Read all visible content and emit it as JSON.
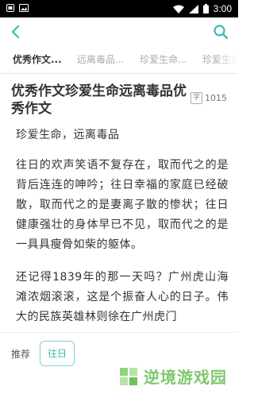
{
  "status_bar": {
    "time": "3:00"
  },
  "tabs": [
    {
      "label": "优秀作文..."
    },
    {
      "label": "远离毒品..."
    },
    {
      "label": "珍爱生命..."
    },
    {
      "label": "珍爱生命"
    }
  ],
  "article": {
    "title": "优秀作文珍爱生命远离毒品优秀作文",
    "wordcount_icon": "字",
    "wordcount": "1015",
    "subtitle": "珍爱生命，远离毒品",
    "paragraphs": [
      "往日的欢声笑语不复存在，取而代之的是背后连连的呻吟；往日幸福的家庭已经破散，取而代之的是妻离子散的惨状；往日健康强壮的身体早已不见，取而代之的是一具具瘦骨如柴的躯体。",
      "还记得1839年的那一天吗？广州虎山海滩浓烟滚滚，这是个振奋人心的日子。伟大的民族英雄林则徐在广州虎门"
    ]
  },
  "bottom": {
    "rec_label": "推荐",
    "rec_tag": "往日",
    "watermark": "逆境游戏园"
  },
  "colors": {
    "accent": "#3fb8b3",
    "watermark": "#7fc86e"
  },
  "icons": [
    "back-arrow-icon",
    "search-icon",
    "wifi-icon",
    "signal-icon",
    "battery-icon"
  ]
}
